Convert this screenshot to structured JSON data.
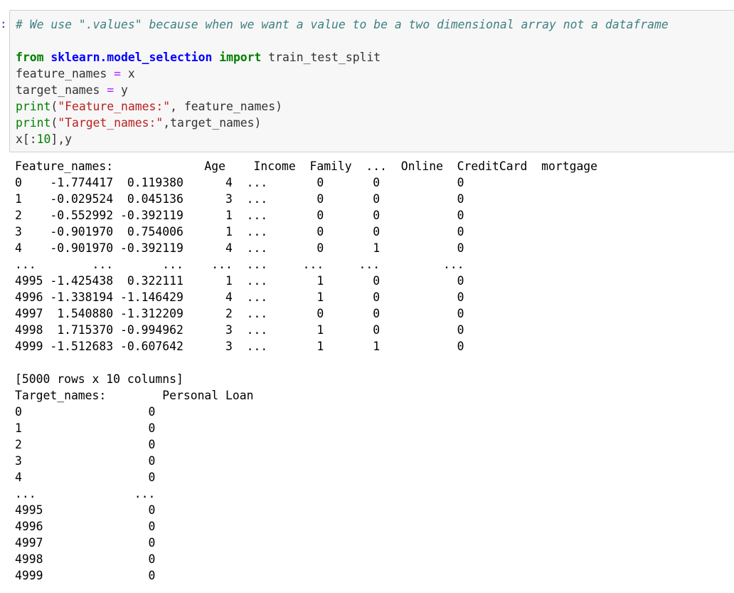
{
  "cell": {
    "prompt": ":",
    "code_lines": [
      [
        {
          "t": "# We use \".values\" because when we want a value to be a two dimensional array not a dataframe",
          "c": "cm-comment"
        }
      ],
      [],
      [
        {
          "t": "from",
          "c": "cm-keyword"
        },
        {
          "t": " ",
          "c": "cm-plain"
        },
        {
          "t": "sklearn.model_selection",
          "c": "cm-module"
        },
        {
          "t": " ",
          "c": "cm-plain"
        },
        {
          "t": "import",
          "c": "cm-keyword"
        },
        {
          "t": " train_test_split",
          "c": "cm-plain"
        }
      ],
      [
        {
          "t": "feature_names ",
          "c": "cm-plain"
        },
        {
          "t": "=",
          "c": "cm-op"
        },
        {
          "t": " x",
          "c": "cm-plain"
        }
      ],
      [
        {
          "t": "target_names ",
          "c": "cm-plain"
        },
        {
          "t": "=",
          "c": "cm-op"
        },
        {
          "t": " y",
          "c": "cm-plain"
        }
      ],
      [
        {
          "t": "print",
          "c": "cm-builtin"
        },
        {
          "t": "(",
          "c": "cm-plain"
        },
        {
          "t": "\"Feature_names:\"",
          "c": "cm-string"
        },
        {
          "t": ", feature_names)",
          "c": "cm-plain"
        }
      ],
      [
        {
          "t": "print",
          "c": "cm-builtin"
        },
        {
          "t": "(",
          "c": "cm-plain"
        },
        {
          "t": "\"Target_names:\"",
          "c": "cm-string"
        },
        {
          "t": ",target_names)",
          "c": "cm-plain"
        }
      ],
      [
        {
          "t": "x[:",
          "c": "cm-plain"
        },
        {
          "t": "10",
          "c": "cm-number"
        },
        {
          "t": "],y",
          "c": "cm-plain"
        }
      ]
    ]
  },
  "output_lines": [
    "Feature_names:             Age    Income  Family  ...  Online  CreditCard  mortgage",
    "0    -1.774417  0.119380      4  ...       0       0           0",
    "1    -0.029524  0.045136      3  ...       0       0           0",
    "2    -0.552992 -0.392119      1  ...       0       0           0",
    "3    -0.901970  0.754006      1  ...       0       0           0",
    "4    -0.901970 -0.392119      4  ...       0       1           0",
    "...        ...       ...    ...  ...     ...     ...         ...",
    "4995 -1.425438  0.322111      1  ...       1       0           0",
    "4996 -1.338194 -1.146429      4  ...       1       0           0",
    "4997  1.540880 -1.312209      2  ...       0       0           0",
    "4998  1.715370 -0.994962      3  ...       1       0           0",
    "4999 -1.512683 -0.607642      3  ...       1       1           0",
    "",
    "[5000 rows x 10 columns]",
    "Target_names:        Personal Loan",
    "0                  0",
    "1                  0",
    "2                  0",
    "3                  0",
    "4                  0",
    "...              ...",
    "4995               0",
    "4996               0",
    "4997               0",
    "4998               0",
    "4999               0"
  ]
}
